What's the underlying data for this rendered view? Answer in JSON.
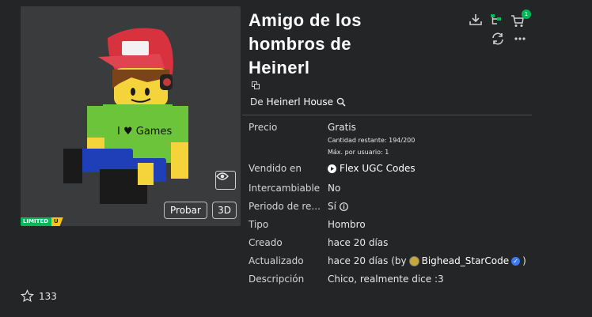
{
  "item": {
    "title": "Amigo de los hombros de Heinerl",
    "creator_prefix": "De",
    "creator_name": "Heinerl House"
  },
  "thumbnail": {
    "badge_limited": "LIMITED",
    "badge_u": "U",
    "shirt_text": "I ♥ Games",
    "try_label": "Probar",
    "view3d_label": "3D"
  },
  "header_icons": {
    "cart_count": "1"
  },
  "details": {
    "price_label": "Precio",
    "price_value": "Gratis",
    "remaining_qty": "Cantidad restante: 194/200",
    "max_per_user": "Máx. por usuario: 1",
    "sold_label": "Vendido en",
    "sold_value": "Flex UGC Codes",
    "tradable_label": "Intercambiable",
    "tradable_value": "No",
    "resale_label": "Periodo de re...",
    "resale_value": "Sí",
    "type_label": "Tipo",
    "type_value": "Hombro",
    "created_label": "Creado",
    "created_value": "hace 20 días",
    "updated_label": "Actualizado",
    "updated_value": "hace 20 días (by",
    "updated_by": "Bighead_StarCode",
    "updated_close": ")",
    "description_label": "Descripción",
    "description_value": "Chico, realmente dice :3"
  },
  "favorites": {
    "count": "133"
  },
  "colors": {
    "background": "#232527",
    "limited_green": "#02b757",
    "limited_yellow": "#f5c518",
    "verified_blue": "#3b7af5"
  }
}
